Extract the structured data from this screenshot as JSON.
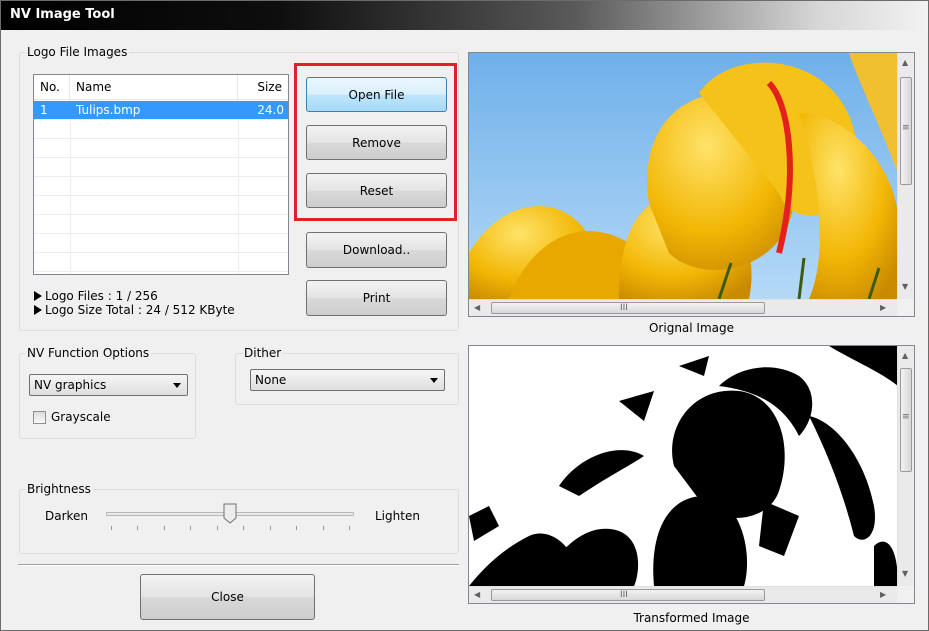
{
  "window": {
    "title": "NV Image Tool"
  },
  "logo_group": {
    "label": "Logo File Images",
    "columns": {
      "no": "No.",
      "name": "Name",
      "size": "Size"
    },
    "rows": [
      {
        "no": "1",
        "name": "Tulips.bmp",
        "size": "24.0"
      }
    ],
    "logo_files": "Logo Files : 1 / 256",
    "logo_size_total": "Logo Size Total : 24 / 512 KByte"
  },
  "buttons": {
    "open_file": "Open File",
    "remove": "Remove",
    "reset": "Reset",
    "download": "Download..",
    "print": "Print",
    "close": "Close"
  },
  "nv_options": {
    "label": "NV Function Options",
    "selected": "NV graphics",
    "grayscale_label": "Grayscale",
    "grayscale_checked": false
  },
  "dither": {
    "label": "Dither",
    "selected": "None"
  },
  "brightness": {
    "label": "Brightness",
    "left_label": "Darken",
    "right_label": "Lighten",
    "value_fraction": 0.5
  },
  "images": {
    "original_caption": "Orignal Image",
    "transformed_caption": "Transformed Image",
    "scroll_grip": "III",
    "vscroll_grip": "≡"
  },
  "colors": {
    "highlight": "#e0202a",
    "selection": "#3399ff",
    "sky": "#8fc3ee",
    "tulip": "#f2b705"
  }
}
